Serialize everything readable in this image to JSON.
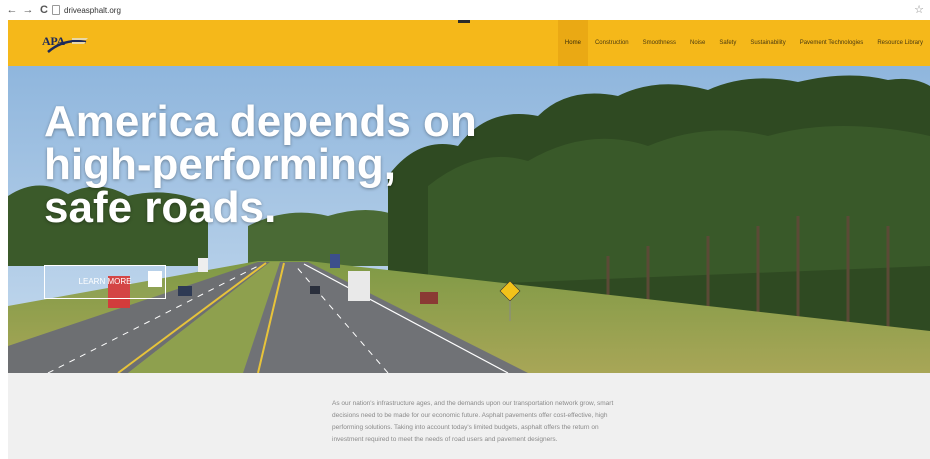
{
  "browser": {
    "url": "driveasphalt.org",
    "back_glyph": "←",
    "forward_glyph": "→",
    "reload_glyph": "C",
    "star_glyph": "☆"
  },
  "header": {
    "logo_text": "APA",
    "nav": [
      {
        "label": "Home",
        "active": true
      },
      {
        "label": "Construction"
      },
      {
        "label": "Smoothness"
      },
      {
        "label": "Noise"
      },
      {
        "label": "Safety"
      },
      {
        "label": "Sustainability"
      },
      {
        "label": "Pavement Technologies"
      },
      {
        "label": "Resource Library"
      }
    ]
  },
  "hero": {
    "headline_lines": [
      "America depends on",
      "high-performing,",
      "safe roads."
    ],
    "cta_label": "LEARN MORE"
  },
  "intro": {
    "text": "As our nation's infrastructure ages, and the demands upon our transportation network grow, smart decisions need to be made for our economic future. Asphalt pavements offer cost-effective, high performing solutions. Taking into account today's limited budgets, asphalt offers the return on investment required to meet the needs of road users and pavement designers."
  },
  "colors": {
    "header": "#f5b81a",
    "nav_active": "#eaa914",
    "sky": "#a9c8e6",
    "trees": "#2f4a22",
    "grass": "#8a9a48",
    "road": "#6d6f72"
  },
  "icons": [
    "back-arrow-icon",
    "forward-arrow-icon",
    "reload-icon",
    "page-icon",
    "bookmark-star-icon",
    "apa-logo-mark"
  ]
}
